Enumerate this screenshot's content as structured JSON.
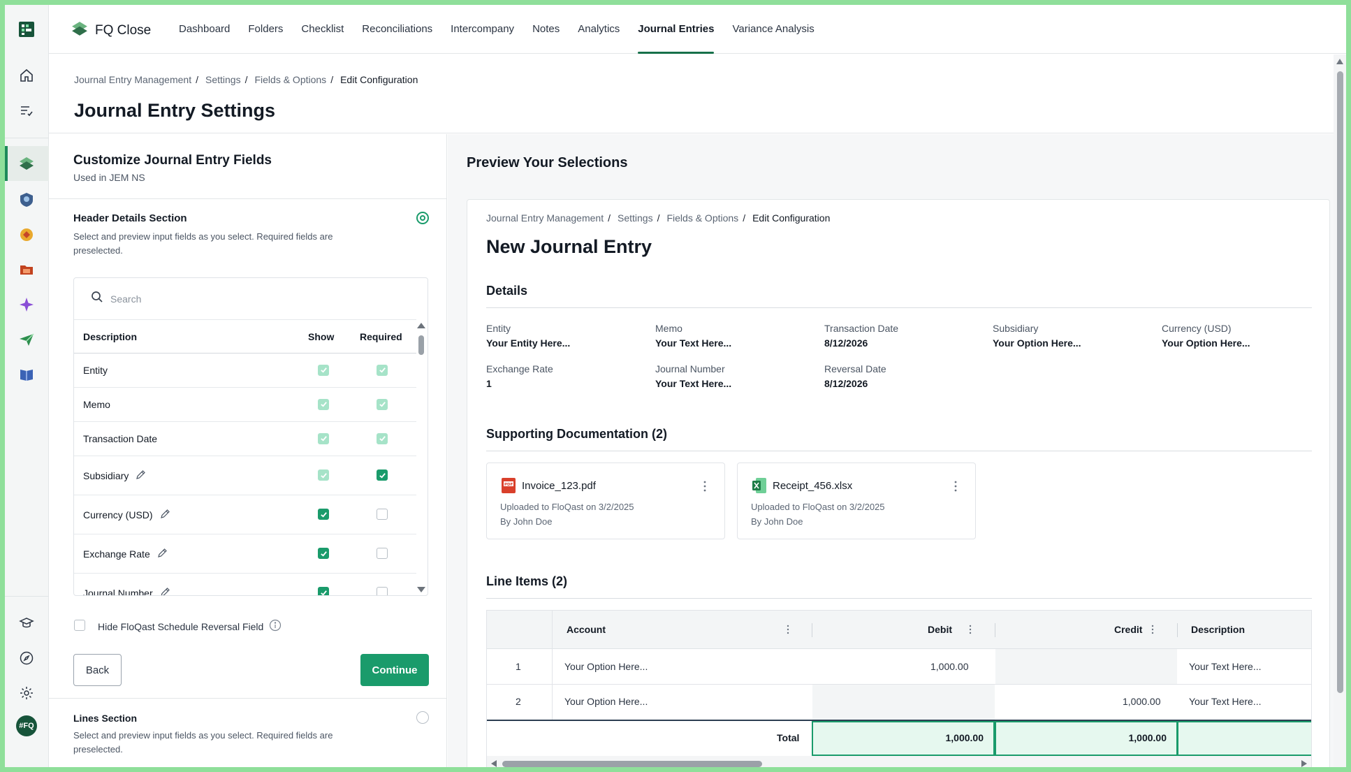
{
  "app": {
    "name": "FQ Close"
  },
  "nav": {
    "items": [
      "Dashboard",
      "Folders",
      "Checklist",
      "Reconciliations",
      "Intercompany",
      "Notes",
      "Analytics",
      "Journal Entries",
      "Variance Analysis"
    ],
    "active": "Journal Entries"
  },
  "rail": {
    "icons": [
      "floqast-logo-icon",
      "home-icon",
      "tasks-icon",
      "close-icon",
      "badge-icon",
      "coin-icon",
      "folder-icon",
      "sparkle-icon",
      "send-icon",
      "book-icon",
      "learning-icon",
      "compass-icon",
      "gear-icon",
      "profile-icon"
    ],
    "profile": "#FQ"
  },
  "breadcrumb": [
    "Journal Entry Management",
    "Settings",
    "Fields & Options",
    "Edit Configuration"
  ],
  "page": {
    "title": "Journal Entry Settings"
  },
  "left": {
    "title": "Customize Journal Entry Fields",
    "subtitle": "Used in JEM NS",
    "header_section": {
      "title": "Header Details Section",
      "desc": "Select and preview input fields as you select. Required fields are preselected."
    },
    "search_placeholder": "Search",
    "table": {
      "headers": {
        "description": "Description",
        "show": "Show",
        "required": "Required"
      },
      "rows": [
        {
          "label": "Entity",
          "editable": false,
          "show": "locked",
          "required": "locked"
        },
        {
          "label": "Memo",
          "editable": false,
          "show": "locked",
          "required": "locked"
        },
        {
          "label": "Transaction Date",
          "editable": false,
          "show": "locked",
          "required": "locked"
        },
        {
          "label": "Subsidiary",
          "editable": true,
          "show": "locked",
          "required": "on"
        },
        {
          "label": "Currency (USD)",
          "editable": true,
          "show": "on",
          "required": "off"
        },
        {
          "label": "Exchange Rate",
          "editable": true,
          "show": "on",
          "required": "off"
        },
        {
          "label": "Journal Number",
          "editable": true,
          "show": "on",
          "required": "off"
        }
      ]
    },
    "hide_reversal_label": "Hide FloQast Schedule Reversal Field",
    "back_label": "Back",
    "continue_label": "Continue",
    "lines_section": {
      "title": "Lines Section",
      "desc": "Select and preview input fields as you select. Required fields are preselected."
    }
  },
  "preview": {
    "title": "Preview Your Selections",
    "breadcrumb": [
      "Journal Entry Management",
      "Settings",
      "Fields & Options",
      "Edit Configuration"
    ],
    "je_title": "New Journal Entry",
    "details_title": "Details",
    "details": [
      {
        "label": "Entity",
        "value": "Your Entity Here..."
      },
      {
        "label": "Memo",
        "value": "Your Text Here..."
      },
      {
        "label": "Transaction Date",
        "value": "8/12/2026"
      },
      {
        "label": "Subsidiary",
        "value": "Your Option Here..."
      },
      {
        "label": "Currency (USD)",
        "value": "Your Option Here..."
      },
      {
        "label": "Exchange Rate",
        "value": "1"
      },
      {
        "label": "Journal Number",
        "value": "Your Text Here..."
      },
      {
        "label": "Reversal Date",
        "value": "8/12/2026"
      }
    ],
    "docs_title": "Supporting Documentation (2)",
    "docs": [
      {
        "name": "Invoice_123.pdf",
        "uploaded": "Uploaded to FloQast on 3/2/2025",
        "by": "By John Doe",
        "type": "pdf-icon"
      },
      {
        "name": "Receipt_456.xlsx",
        "uploaded": "Uploaded to FloQast on 3/2/2025",
        "by": "By John Doe",
        "type": "excel-icon"
      }
    ],
    "lines_title": "Line Items (2)",
    "grid": {
      "headers": {
        "account": "Account",
        "debit": "Debit",
        "credit": "Credit",
        "description": "Description"
      },
      "rows": [
        {
          "num": "1",
          "account": "Your Option Here...",
          "debit": "1,000.00",
          "credit": "",
          "description": "Your Text Here..."
        },
        {
          "num": "2",
          "account": "Your Option Here...",
          "debit": "",
          "credit": "1,000.00",
          "description": "Your Text Here..."
        }
      ],
      "total_label": "Total",
      "total_debit": "1,000.00",
      "total_credit": "1,000.00"
    }
  },
  "colors": {
    "accent": "#1a9b6b",
    "active_nav": "#17704a",
    "total_fill": "#e6f8ef"
  }
}
